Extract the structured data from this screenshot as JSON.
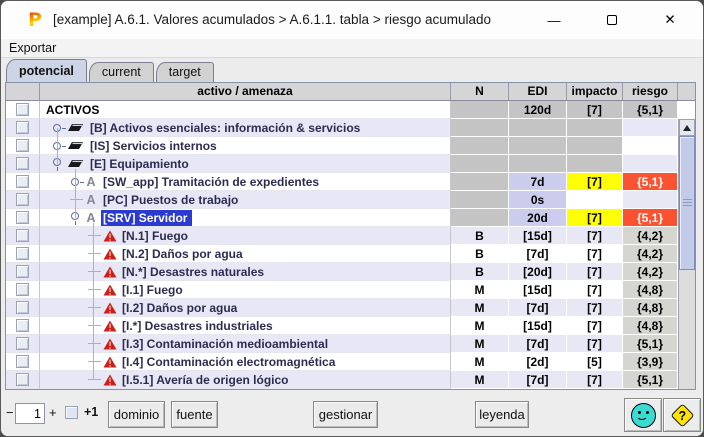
{
  "window": {
    "title": "[example] A.6.1. Valores acumulados > A.6.1.1. tabla > riesgo acumulado",
    "logo_letter": "P",
    "minimize_glyph": "—",
    "close_glyph": "✕"
  },
  "menu": {
    "items": [
      {
        "label": "Exportar"
      }
    ]
  },
  "tabs": {
    "items": [
      {
        "label": "potencial",
        "selected": true
      },
      {
        "label": "current",
        "selected": false
      },
      {
        "label": "target",
        "selected": false
      }
    ]
  },
  "table": {
    "headers": {
      "checkbox": "",
      "tree": "activo / amenaza",
      "n": "N",
      "edi": "EDI",
      "impacto": "impacto",
      "riesgo": "riesgo"
    },
    "rows": [
      {
        "label": "ACTIVOS",
        "level": 0,
        "icon": "none",
        "handle": "none",
        "selected": false,
        "n": "",
        "edi": "120d",
        "impacto": "[7]",
        "riesgo": "{5,1}",
        "styles": {
          "n": "block",
          "edi": "block",
          "impacto": "block",
          "riesgo": "block"
        }
      },
      {
        "label": "[B] Activos esenciales: información & servicios",
        "level": 1,
        "icon": "group",
        "handle": "collapsed",
        "selected": false,
        "n": "",
        "edi": "",
        "impacto": "",
        "riesgo": "",
        "styles": {
          "n": "block",
          "edi": "block",
          "impacto": "block",
          "riesgo": "plain"
        }
      },
      {
        "label": "[IS] Servicios internos",
        "level": 1,
        "icon": "group",
        "handle": "collapsed",
        "selected": false,
        "n": "",
        "edi": "",
        "impacto": "",
        "riesgo": "",
        "styles": {
          "n": "block",
          "edi": "block",
          "impacto": "block",
          "riesgo": "plain"
        }
      },
      {
        "label": "[E] Equipamiento",
        "level": 1,
        "icon": "group",
        "handle": "expanded",
        "selected": false,
        "n": "",
        "edi": "",
        "impacto": "",
        "riesgo": "",
        "styles": {
          "n": "block",
          "edi": "block",
          "impacto": "block",
          "riesgo": "plain"
        }
      },
      {
        "label": "[SW_app] Tramitación de expedientes",
        "level": 2,
        "icon": "asset",
        "handle": "collapsed",
        "selected": false,
        "n": "",
        "edi": "7d",
        "impacto": "[7]",
        "riesgo": "{5,1}",
        "styles": {
          "n": "block",
          "edi": "value",
          "impacto": "editable",
          "riesgo": "risk-high"
        }
      },
      {
        "label": "[PC] Puestos de trabajo",
        "level": 2,
        "icon": "asset",
        "handle": "leaf",
        "selected": false,
        "n": "",
        "edi": "0s",
        "impacto": "",
        "riesgo": "",
        "styles": {
          "n": "block",
          "edi": "value",
          "impacto": "white",
          "riesgo": "plain"
        }
      },
      {
        "label": "[SRV] Servidor",
        "level": 2,
        "icon": "asset",
        "handle": "expanded",
        "selected": true,
        "n": "",
        "edi": "20d",
        "impacto": "[7]",
        "riesgo": "{5,1}",
        "styles": {
          "n": "block",
          "edi": "value",
          "impacto": "editable",
          "riesgo": "risk-high"
        }
      },
      {
        "label": "[N.1] Fuego",
        "level": 3,
        "icon": "threat",
        "handle": "leaf",
        "selected": false,
        "n": "B",
        "edi": "[15d]",
        "impacto": "[7]",
        "riesgo": "{4,2}",
        "styles": {
          "n": "plain",
          "edi": "plain",
          "impacto": "plain",
          "riesgo": "risk-gray"
        }
      },
      {
        "label": "[N.2] Daños por agua",
        "level": 3,
        "icon": "threat",
        "handle": "leaf",
        "selected": false,
        "n": "B",
        "edi": "[7d]",
        "impacto": "[7]",
        "riesgo": "{4,2}",
        "styles": {
          "n": "plain",
          "edi": "plain",
          "impacto": "plain",
          "riesgo": "risk-gray"
        }
      },
      {
        "label": "[N.*] Desastres naturales",
        "level": 3,
        "icon": "threat",
        "handle": "leaf",
        "selected": false,
        "n": "B",
        "edi": "[20d]",
        "impacto": "[7]",
        "riesgo": "{4,2}",
        "styles": {
          "n": "plain",
          "edi": "plain",
          "impacto": "plain",
          "riesgo": "risk-gray"
        }
      },
      {
        "label": "[I.1] Fuego",
        "level": 3,
        "icon": "threat",
        "handle": "leaf",
        "selected": false,
        "n": "M",
        "edi": "[15d]",
        "impacto": "[7]",
        "riesgo": "{4,8}",
        "styles": {
          "n": "plain",
          "edi": "plain",
          "impacto": "plain",
          "riesgo": "risk-gray"
        }
      },
      {
        "label": "[I.2] Daños por agua",
        "level": 3,
        "icon": "threat",
        "handle": "leaf",
        "selected": false,
        "n": "M",
        "edi": "[7d]",
        "impacto": "[7]",
        "riesgo": "{4,8}",
        "styles": {
          "n": "plain",
          "edi": "plain",
          "impacto": "plain",
          "riesgo": "risk-gray"
        }
      },
      {
        "label": "[I.*] Desastres industriales",
        "level": 3,
        "icon": "threat",
        "handle": "leaf",
        "selected": false,
        "n": "M",
        "edi": "[15d]",
        "impacto": "[7]",
        "riesgo": "{4,8}",
        "styles": {
          "n": "plain",
          "edi": "plain",
          "impacto": "plain",
          "riesgo": "risk-gray"
        }
      },
      {
        "label": "[I.3] Contaminación medioambiental",
        "level": 3,
        "icon": "threat",
        "handle": "leaf",
        "selected": false,
        "n": "M",
        "edi": "[7d]",
        "impacto": "[7]",
        "riesgo": "{5,1}",
        "styles": {
          "n": "plain",
          "edi": "plain",
          "impacto": "plain",
          "riesgo": "risk-gray"
        }
      },
      {
        "label": "[I.4] Contaminación electromagnética",
        "level": 3,
        "icon": "threat",
        "handle": "leaf",
        "selected": false,
        "n": "M",
        "edi": "[2d]",
        "impacto": "[5]",
        "riesgo": "{3,9}",
        "styles": {
          "n": "plain",
          "edi": "plain",
          "impacto": "plain",
          "riesgo": "risk-gray"
        }
      },
      {
        "label": "[I.5.1] Avería de origen lógico",
        "level": 3,
        "icon": "threat",
        "handle": "leaf",
        "selected": false,
        "n": "M",
        "edi": "[7d]",
        "impacto": "[7]",
        "riesgo": "{5,1}",
        "styles": {
          "n": "plain",
          "edi": "plain",
          "impacto": "plain",
          "riesgo": "risk-gray"
        }
      }
    ]
  },
  "footer": {
    "minus_label": "−",
    "spinner_value": "1",
    "plus_label": "+",
    "plus_one_label": "+1",
    "buttons": [
      {
        "label": "dominio"
      },
      {
        "label": "fuente"
      },
      {
        "label": "gestionar"
      },
      {
        "label": "leyenda"
      }
    ],
    "smiley_icon": "smiley-face",
    "help_icon": "question-diamond"
  },
  "icons": {
    "asset_glyph": "A"
  },
  "colors": {
    "selection": "#2b3bd0",
    "row_alt": "#e7e7f5",
    "cell_block": "#c4c4c4",
    "cell_value": "#ccccee",
    "cell_editable": "#ffff00",
    "cell_risk_high": "#fb5331",
    "cell_risk_gray": "#d6d6d0",
    "tab_selected": "#ccd4e6"
  }
}
